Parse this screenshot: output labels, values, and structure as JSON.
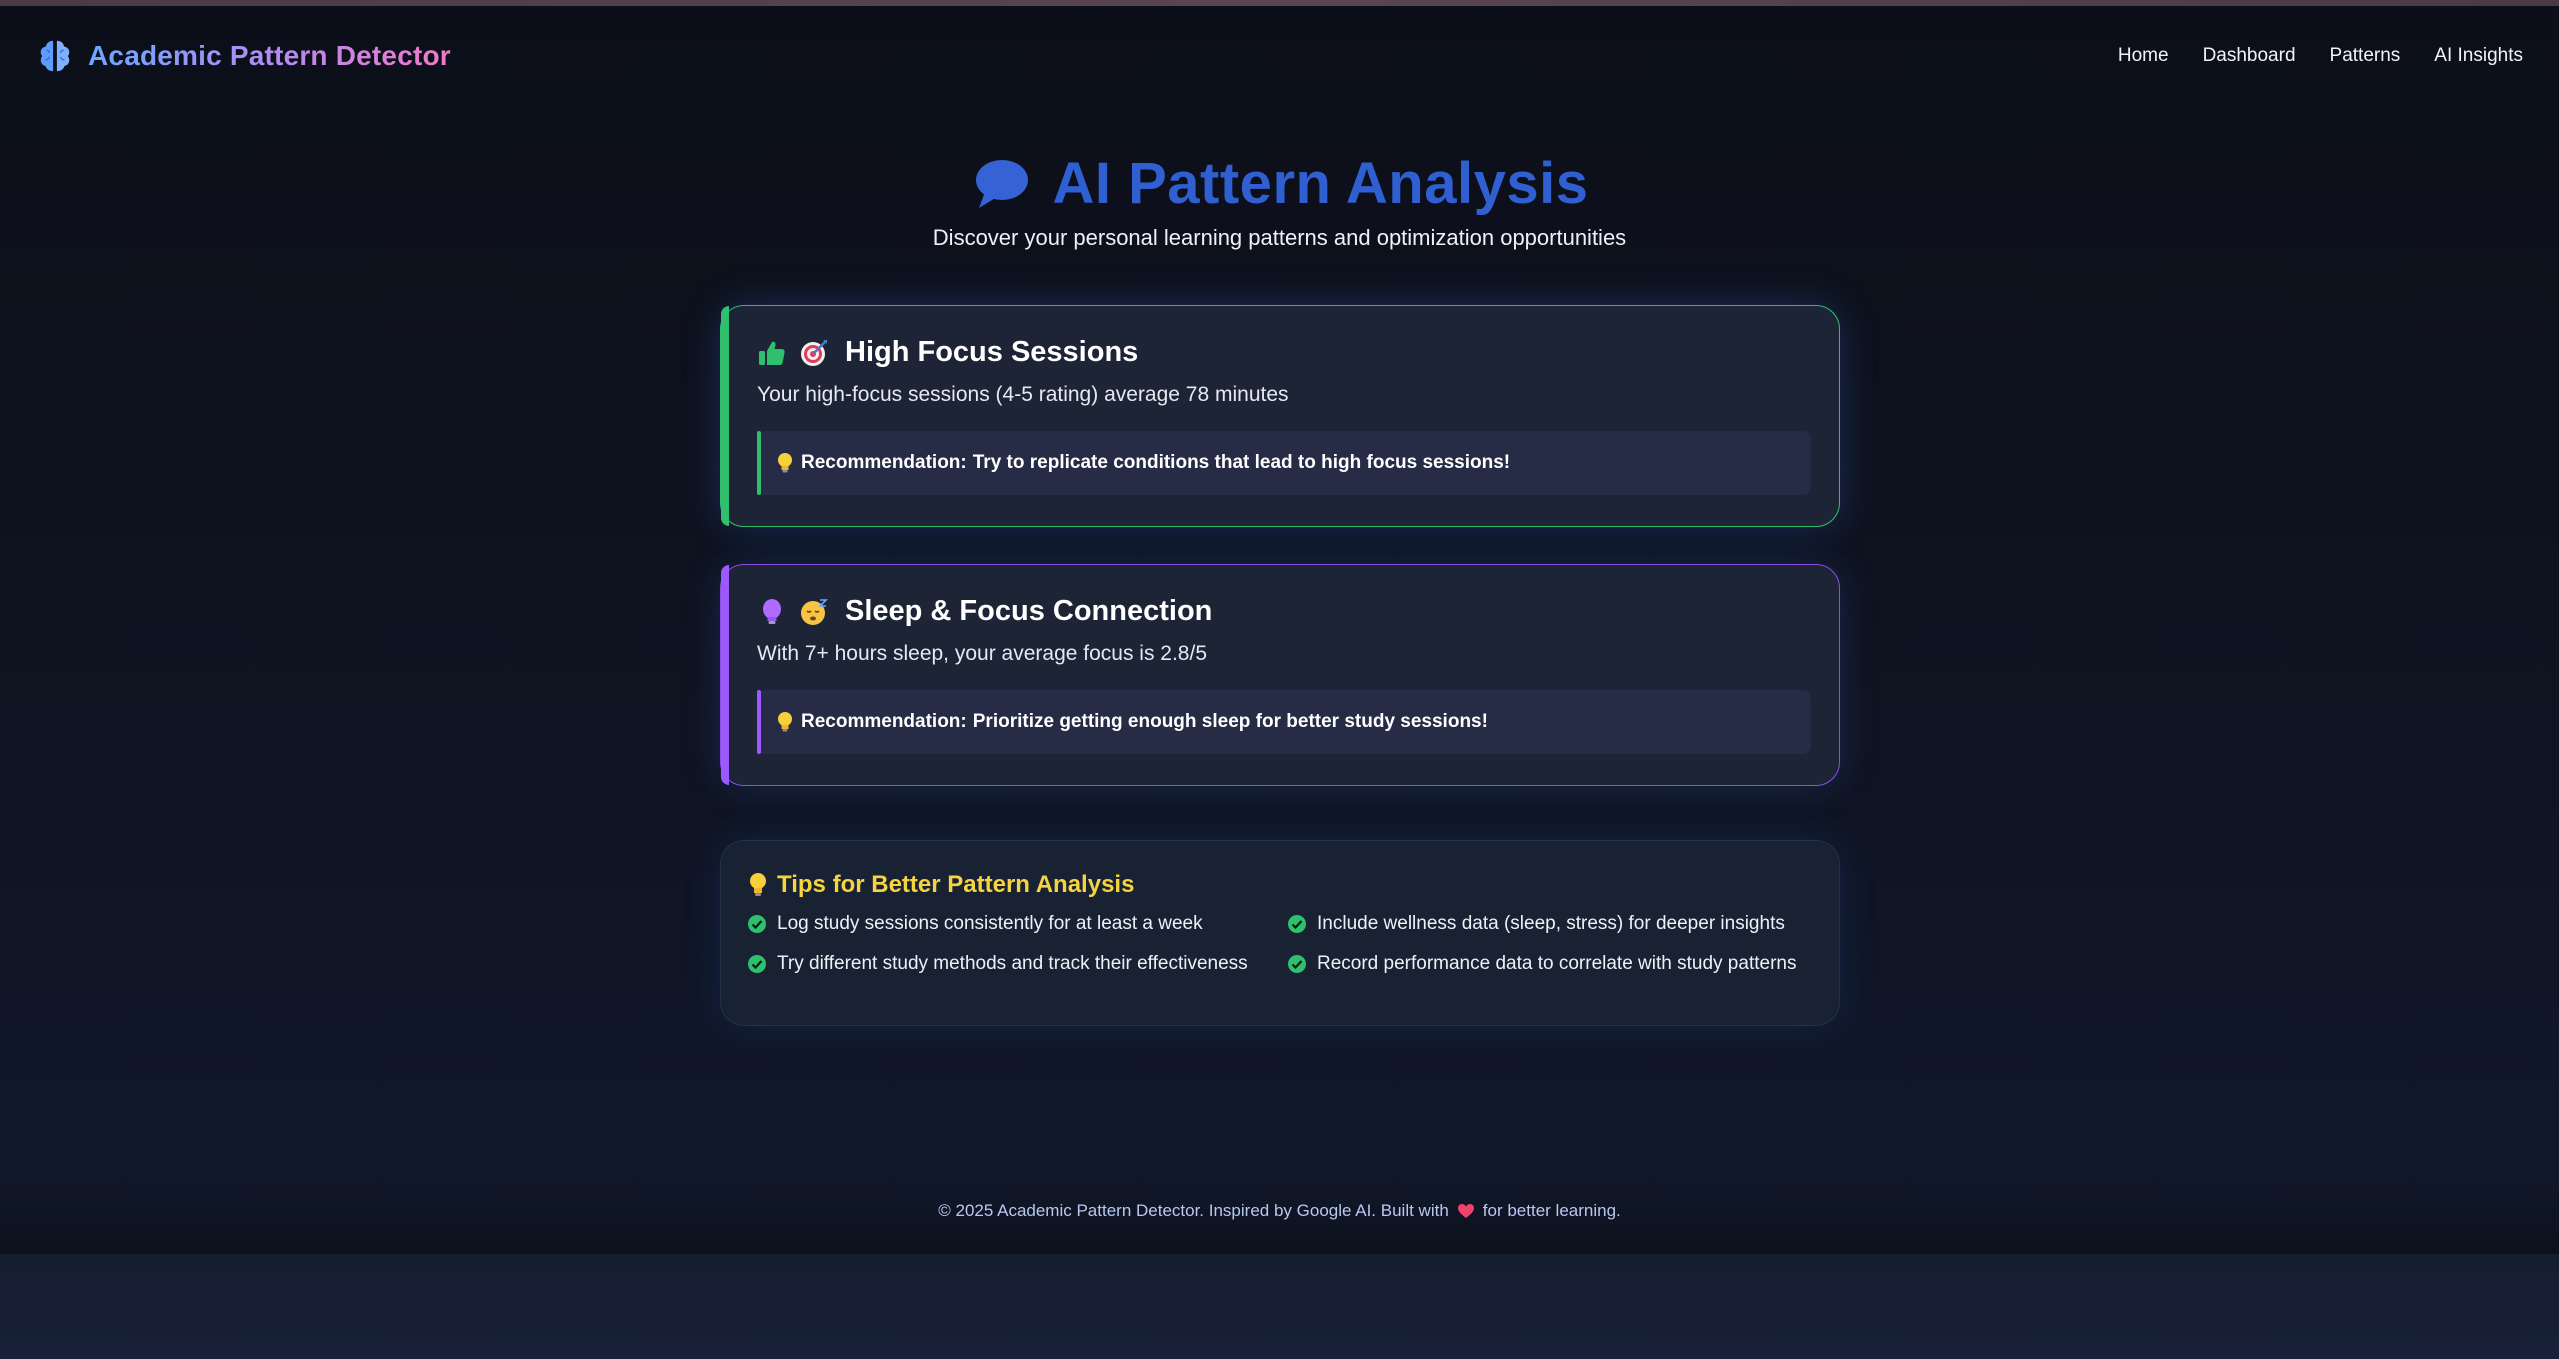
{
  "header": {
    "brand_title": "Academic Pattern Detector",
    "brand_icon": "brain-icon",
    "nav": [
      {
        "label": "Home"
      },
      {
        "label": "Dashboard"
      },
      {
        "label": "Patterns"
      },
      {
        "label": "AI Insights"
      }
    ]
  },
  "hero": {
    "title": "AI Pattern Analysis",
    "icon": "speech-bubble-icon",
    "subtitle": "Discover your personal learning patterns and optimization opportunities"
  },
  "insights": [
    {
      "title": "High Focus Sessions",
      "icons": [
        "thumbs-up-icon",
        "target-icon"
      ],
      "description": "Your high-focus sessions (4-5 rating) average 78 minutes",
      "recommendation_label": "Recommendation:",
      "recommendation_text": "Try to replicate conditions that lead to high focus sessions!",
      "accent": "#2fbf6d"
    },
    {
      "title": "Sleep & Focus Connection",
      "icons": [
        "lightbulb-icon",
        "sleeping-face-icon"
      ],
      "description": "With 7+ hours sleep, your average focus is 2.8/5",
      "recommendation_label": "Recommendation:",
      "recommendation_text": "Prioritize getting enough sleep for better study sessions!",
      "accent": "#9b59ff"
    }
  ],
  "tips": {
    "title": "Tips for Better Pattern Analysis",
    "items": [
      "Log study sessions consistently for at least a week",
      "Include wellness data (sleep, stress) for deeper insights",
      "Try different study methods and track their effectiveness",
      "Record performance data to correlate with study patterns"
    ]
  },
  "footer": {
    "text_before": "© 2025 Academic Pattern Detector. Inspired by Google AI. Built with",
    "text_after": "for better learning."
  },
  "colors": {
    "title_blue": "#2f5fd1",
    "tips_yellow": "#f5d442",
    "green": "#2fbf6d",
    "purple": "#9b59ff"
  }
}
